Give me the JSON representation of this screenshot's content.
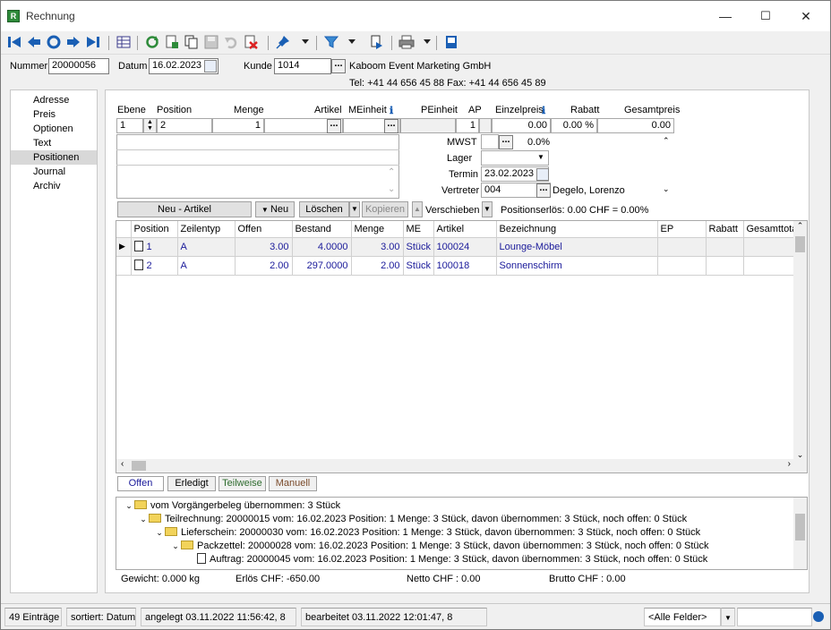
{
  "window": {
    "title": "Rechnung",
    "app_icon": "R",
    "min": "—",
    "max": "☐",
    "close": "✕"
  },
  "toolbar_icons": [
    "first-record",
    "previous-record",
    "refresh-nav",
    "next-record",
    "last-record",
    "table-view",
    "reload",
    "new-document",
    "copy-document",
    "save",
    "undo",
    "delete",
    "pin",
    "filter",
    "export",
    "print",
    "info"
  ],
  "header": {
    "nummer_label": "Nummer",
    "nummer": "20000056",
    "datum_label": "Datum",
    "datum": "16.02.2023",
    "kunde_label": "Kunde",
    "kunde": "1014",
    "kunde_name": "Kaboom Event Marketing GmbH",
    "kunde_contact": "Tel: +41 44 656 45 88   Fax: +41 44 656 45 89"
  },
  "nav": [
    "Adresse",
    "Preis",
    "Optionen",
    "Text",
    "Positionen",
    "Journal",
    "Archiv"
  ],
  "position_fields": {
    "headers": {
      "ebene": "Ebene",
      "position": "Position",
      "menge": "Menge",
      "artikel": "Artikel",
      "meinheit": "MEinheit",
      "peinheit": "PEinheit",
      "ap": "AP",
      "einzelpreis": "Einzelpreis",
      "rabatt": "Rabatt",
      "gesamtpreis": "Gesamtpreis"
    },
    "values": {
      "ebene": "1",
      "position": "2",
      "menge": "1",
      "peinheit": "1",
      "einzelpreis": "0.00",
      "rabatt": "0.00 %",
      "gesamtpreis": "0.00"
    },
    "mwst_label": "MWST",
    "mwst": "0.0%",
    "lager_label": "Lager",
    "termin_label": "Termin",
    "termin": "23.02.2023",
    "vertreter_label": "Vertreter",
    "vertreter": "004",
    "vertreter_name": "Degelo, Lorenzo"
  },
  "actions": {
    "neu_artikel": "Neu - Artikel",
    "neu": "Neu",
    "loeschen": "Löschen",
    "kopieren": "Kopieren",
    "verschieben": "Verschieben",
    "positionserloes": "Positionserlös:  0.00 CHF = 0.00%"
  },
  "grid": {
    "columns": [
      "Position",
      "Zeilentyp",
      "Offen",
      "Bestand",
      "Menge",
      "ME",
      "Artikel",
      "Bezeichnung",
      "EP",
      "Rabatt",
      "Gesamttota"
    ],
    "rows": [
      {
        "position": "1",
        "zeilentyp": "A",
        "offen": "3.00",
        "bestand": "4.0000",
        "menge": "3.00",
        "me": "Stück",
        "artikel": "100024",
        "bezeichnung": "Lounge-Möbel"
      },
      {
        "position": "2",
        "zeilentyp": "A",
        "offen": "2.00",
        "bestand": "297.0000",
        "menge": "2.00",
        "me": "Stück",
        "artikel": "100018",
        "bezeichnung": "Sonnenschirm"
      }
    ]
  },
  "tabs": [
    "Offen",
    "Erledigt",
    "Teilweise",
    "Manuell"
  ],
  "tree": [
    "vom Vorgängerbeleg übernommen: 3 Stück",
    "Teilrechnung: 20000015 vom: 16.02.2023 Position: 1 Menge: 3 Stück, davon übernommen: 3 Stück, noch offen: 0 Stück",
    "Lieferschein: 20000030 vom: 16.02.2023 Position: 1 Menge: 3 Stück, davon übernommen: 3 Stück, noch offen: 0 Stück",
    "Packzettel: 20000028 vom: 16.02.2023 Position: 1 Menge: 3 Stück, davon übernommen: 3 Stück, noch offen: 0 Stück",
    "Auftrag: 20000045 vom: 16.02.2023 Position: 1 Menge: 3 Stück, davon übernommen: 3 Stück, noch offen: 0 Stück"
  ],
  "totals": {
    "gewicht": "Gewicht:  0.000 kg",
    "erloes": "Erlös CHF: -650.00",
    "netto": "Netto CHF :  0.00",
    "brutto": "Brutto CHF :  0.00"
  },
  "status": {
    "count": "49 Einträge",
    "sorted": "sortiert: Datum",
    "created": "angelegt 03.11.2022 11:56:42,  8",
    "edited": "bearbeitet 03.11.2022 12:01:47,  8",
    "field_select": "<Alle Felder>"
  },
  "colors": {
    "accent_blue": "#1a5fb4",
    "text_blue": "#1a1a9a"
  }
}
